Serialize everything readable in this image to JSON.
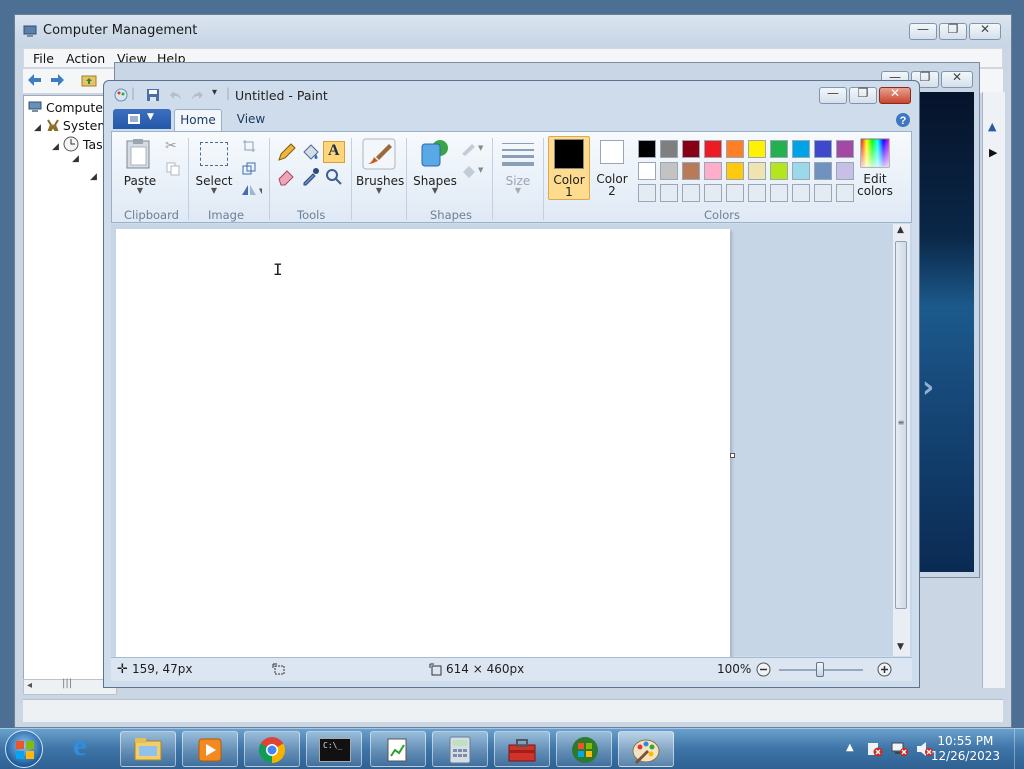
{
  "cm": {
    "title": "Computer Management",
    "menu": [
      "File",
      "Action",
      "View",
      "Help"
    ],
    "tree": [
      "Computer",
      "System",
      "Tas"
    ]
  },
  "paint": {
    "title": "Untitled - Paint",
    "tabs": [
      "Home",
      "View"
    ],
    "groups": {
      "clipboard": "Clipboard",
      "image": "Image",
      "tools": "Tools",
      "shapes": "Shapes",
      "colors": "Colors"
    },
    "buttons": {
      "paste": "Paste",
      "select": "Select",
      "brushes": "Brushes",
      "shapes": "Shapes",
      "size": "Size",
      "color1_line1": "Color",
      "color1_line2": "1",
      "color2_line1": "Color",
      "color2_line2": "2",
      "edit_colors_line1": "Edit",
      "edit_colors_line2": "colors"
    },
    "palette_row1": [
      "#000000",
      "#7f7f7f",
      "#880015",
      "#ed1c24",
      "#ff7f27",
      "#fff200",
      "#22b14c",
      "#00a2e8",
      "#3f48cc",
      "#a349a4"
    ],
    "palette_row2": [
      "#ffffff",
      "#c3c3c3",
      "#b97a57",
      "#ffaec9",
      "#ffc90e",
      "#efe4b0",
      "#b5e61d",
      "#99d9ea",
      "#7092be",
      "#c8bfe7"
    ],
    "color1": "#000000",
    "color2": "#ffffff",
    "status": {
      "cursor_pos": "159, 47px",
      "canvas_size": "614 × 460px",
      "zoom": "100%"
    }
  },
  "clock": {
    "time": "10:55 PM",
    "date": "12/26/2023"
  }
}
